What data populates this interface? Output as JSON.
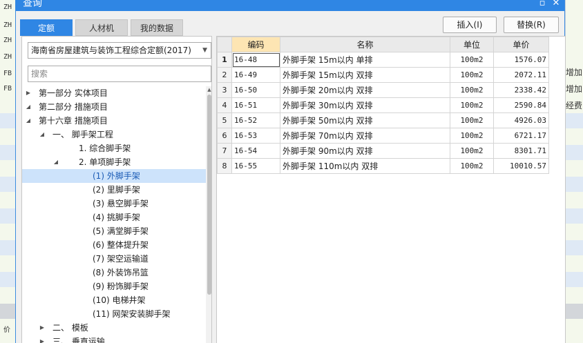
{
  "background_app": {
    "left_row_codes": [
      "ZH",
      "ZH",
      "ZH",
      "ZH",
      "FB",
      "FB"
    ],
    "right_texts": [
      "增加",
      "增加",
      "经费"
    ],
    "bottom_left_text": "价"
  },
  "dialog": {
    "title": "查询",
    "tabs": [
      {
        "label": "定额",
        "active": true
      },
      {
        "label": "人材机",
        "active": false
      },
      {
        "label": "我的数据",
        "active": false
      }
    ],
    "insert_label": "插入(I)",
    "replace_label": "替换(R)",
    "quota_library": "海南省房屋建筑与装饰工程综合定额(2017)",
    "search_placeholder": "搜索",
    "tree": [
      {
        "label": "第一部分 实体项目",
        "level": 0,
        "toggle": "collapsed"
      },
      {
        "label": "第二部分 措施项目",
        "level": 0,
        "toggle": "expanded"
      },
      {
        "label": "第十六章 措施项目",
        "level": 1,
        "toggle": "expanded"
      },
      {
        "label": "一、 脚手架工程",
        "level": 2,
        "toggle": "expanded"
      },
      {
        "label": "1. 综合脚手架",
        "level": 3,
        "toggle": "none"
      },
      {
        "label": "2. 单项脚手架",
        "level": 3,
        "toggle": "expanded"
      },
      {
        "label": "(1) 外脚手架",
        "level": 4,
        "toggle": "none",
        "selected": true
      },
      {
        "label": "(2) 里脚手架",
        "level": 4,
        "toggle": "none"
      },
      {
        "label": "(3) 悬空脚手架",
        "level": 4,
        "toggle": "none"
      },
      {
        "label": "(4) 挑脚手架",
        "level": 4,
        "toggle": "none"
      },
      {
        "label": "(5) 满堂脚手架",
        "level": 4,
        "toggle": "none"
      },
      {
        "label": "(6) 整体提升架",
        "level": 4,
        "toggle": "none"
      },
      {
        "label": "(7) 架空运输道",
        "level": 4,
        "toggle": "none"
      },
      {
        "label": "(8) 外装饰吊篮",
        "level": 4,
        "toggle": "none"
      },
      {
        "label": "(9) 粉饰脚手架",
        "level": 4,
        "toggle": "none"
      },
      {
        "label": "(10) 电梯井架",
        "level": 4,
        "toggle": "none"
      },
      {
        "label": "(11) 网架安装脚手架",
        "level": 4,
        "toggle": "none"
      },
      {
        "label": "二、 模板",
        "level": 2,
        "toggle": "collapsed"
      },
      {
        "label": "三、 垂直运输",
        "level": 2,
        "toggle": "collapsed"
      }
    ],
    "table": {
      "columns": [
        "编码",
        "名称",
        "单位",
        "单价"
      ],
      "rows": [
        {
          "idx": "1",
          "code": "16-48",
          "name": "外脚手架 15m以内 单排",
          "unit": "100m2",
          "price": "1576.07"
        },
        {
          "idx": "2",
          "code": "16-49",
          "name": "外脚手架 15m以内 双排",
          "unit": "100m2",
          "price": "2072.11"
        },
        {
          "idx": "3",
          "code": "16-50",
          "name": "外脚手架 20m以内 双排",
          "unit": "100m2",
          "price": "2338.42"
        },
        {
          "idx": "4",
          "code": "16-51",
          "name": "外脚手架 30m以内 双排",
          "unit": "100m2",
          "price": "2590.84"
        },
        {
          "idx": "5",
          "code": "16-52",
          "name": "外脚手架 50m以内 双排",
          "unit": "100m2",
          "price": "4926.03"
        },
        {
          "idx": "6",
          "code": "16-53",
          "name": "外脚手架 70m以内 双排",
          "unit": "100m2",
          "price": "6721.17"
        },
        {
          "idx": "7",
          "code": "16-54",
          "name": "外脚手架 90m以内 双排",
          "unit": "100m2",
          "price": "8301.71"
        },
        {
          "idx": "8",
          "code": "16-55",
          "name": "外脚手架 110m以内 双排",
          "unit": "100m2",
          "price": "10010.57"
        }
      ]
    }
  }
}
